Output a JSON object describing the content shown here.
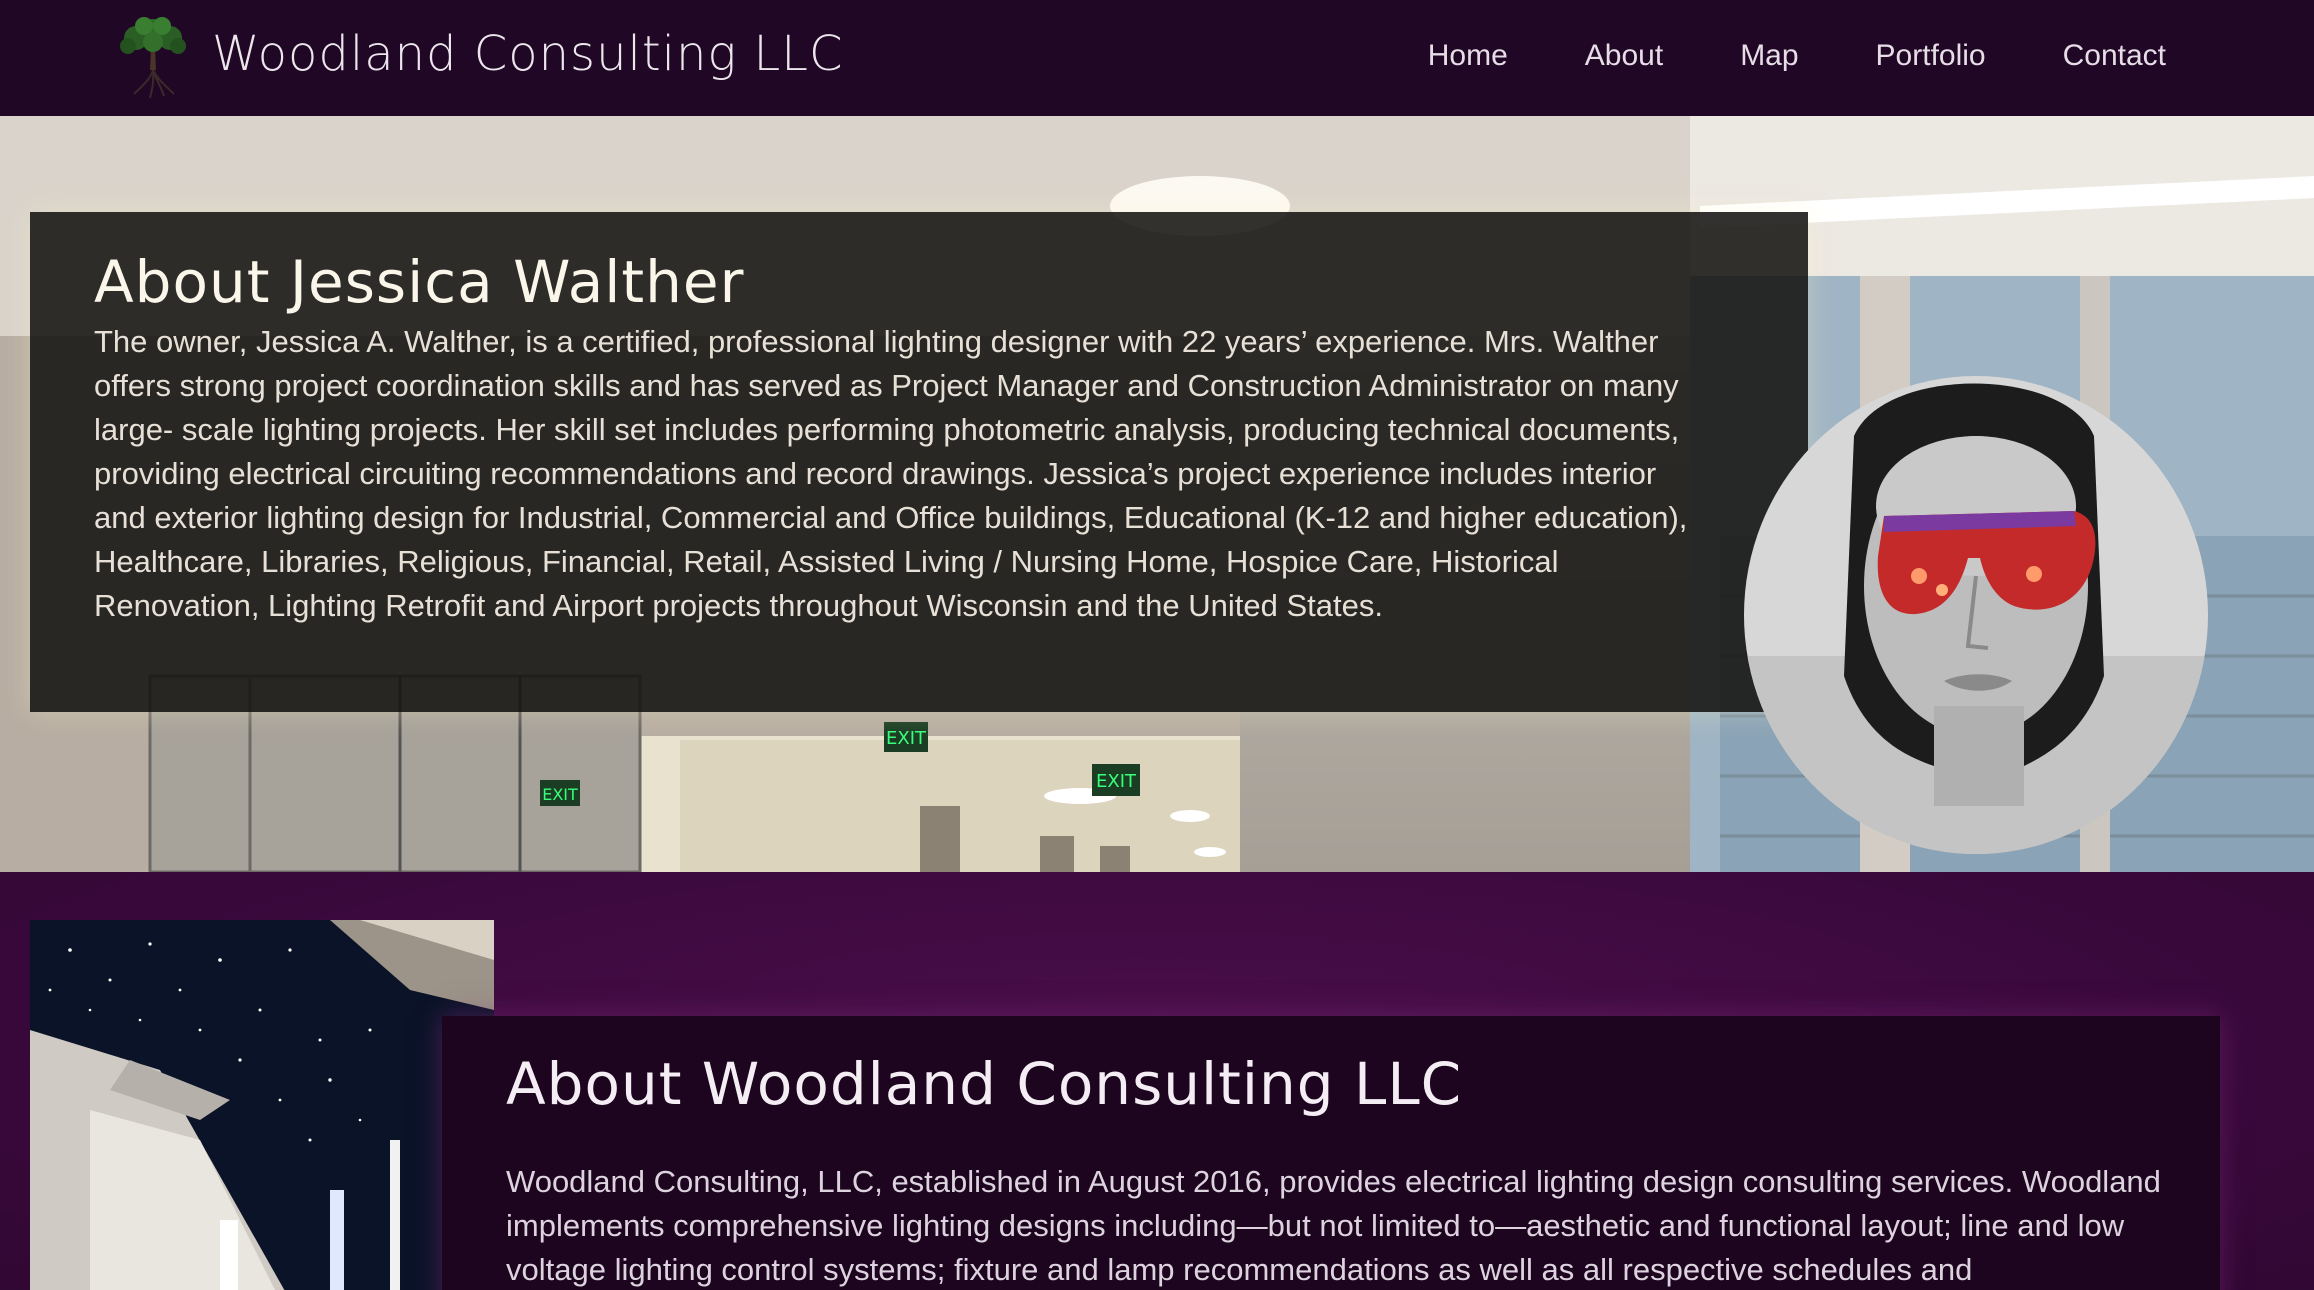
{
  "header": {
    "brand": "Woodland Consulting LLC",
    "logo_icon": "tree-icon",
    "nav": [
      {
        "label": "Home"
      },
      {
        "label": "About"
      },
      {
        "label": "Map"
      },
      {
        "label": "Portfolio"
      },
      {
        "label": "Contact"
      }
    ]
  },
  "about_owner": {
    "title": "About Jessica Walther",
    "text": "The owner, Jessica A. Walther, is a certified, professional lighting designer with 22 years’ experience. Mrs. Walther offers strong project coordination skills and has served as Project Manager and Construction Administrator on many large- scale lighting projects. Her skill set includes performing photometric analysis, producing technical documents, providing electrical circuiting recommendations and record drawings. Jessica’s project experience includes interior and exterior lighting design for Industrial, Commercial and Office buildings, Educational (K-12 and higher education), Healthcare, Libraries, Religious, Financial, Retail, Assisted Living / Nursing Home, Hospice Care, Historical Renovation, Lighting Retrofit and Airport projects throughout Wisconsin and the United States."
  },
  "about_company": {
    "title": "About Woodland Consulting LLC",
    "text": "Woodland Consulting, LLC, established in August 2016, provides electrical lighting design consulting services. Woodland implements comprehensive lighting designs including—but not limited to—aesthetic and functional layout; line and low voltage lighting control systems; fixture and lamp recommendations as well as all respective schedules and specifications."
  },
  "hero": {
    "exit_sign_1": "EXIT",
    "exit_sign_2": "EXIT",
    "exit_sign_3": "EXIT"
  },
  "colors": {
    "header_bg": "#200726",
    "section_bg": "#3e0a3e",
    "card_dark": "#161412",
    "card_purple": "#1d0520"
  }
}
